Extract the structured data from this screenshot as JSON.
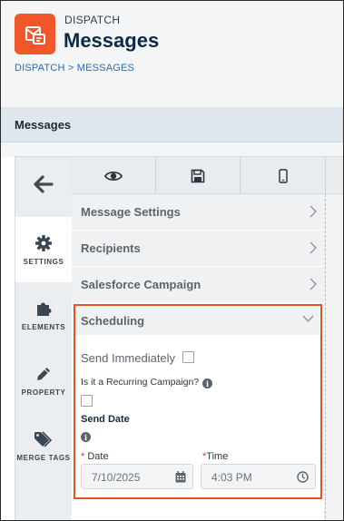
{
  "header": {
    "app_label": "DISPATCH",
    "title": "Messages",
    "breadcrumb": "DISPATCH > MESSAGES"
  },
  "band": {
    "title": "Messages"
  },
  "rail": {
    "back_icon": "arrow-left-icon",
    "items": [
      {
        "label": "SETTINGS",
        "icon": "gear-icon",
        "active": true
      },
      {
        "label": "ELEMENTS",
        "icon": "puzzle-icon",
        "active": false
      },
      {
        "label": "PROPERTY",
        "icon": "pencil-icon",
        "active": false
      },
      {
        "label": "MERGE TAGS",
        "icon": "tag-icon",
        "active": false
      }
    ]
  },
  "toolbar": {
    "buttons": [
      {
        "icon": "eye-icon"
      },
      {
        "icon": "save-icon"
      },
      {
        "icon": "mobile-icon"
      }
    ]
  },
  "sections": [
    {
      "title": "Message Settings",
      "icon": "chevron-right-icon"
    },
    {
      "title": "Recipients",
      "icon": "chevron-right-icon"
    },
    {
      "title": "Salesforce Campaign",
      "icon": "chevron-right-icon"
    }
  ],
  "scheduling": {
    "title": "Scheduling",
    "send_immediately_label": "Send Immediately",
    "send_immediately_checked": false,
    "recurring_label": "Is it a Recurring Campaign?",
    "recurring_checked": false,
    "send_date_label": "Send Date",
    "required_mark": "*",
    "date_label": "Date",
    "date_value": "7/10/2025",
    "time_label": "Time",
    "time_value": "4:03 PM"
  },
  "colors": {
    "accent": "#f0582b",
    "highlight_border": "#e2551b",
    "link": "#2a6db1",
    "title": "#0b2a45"
  }
}
